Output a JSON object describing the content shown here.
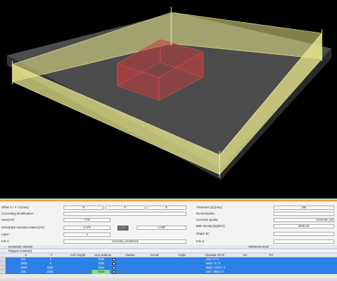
{
  "viewport": {
    "background": "#000000",
    "slab_color": "#4a4a4a",
    "wall_color": "#e8e88c",
    "opening_color": "#c44040"
  },
  "properties": {
    "accent_bar": "#e8a63a",
    "offset_label": "Offset X / Y / Z [mm]:",
    "offset_x": "0",
    "offset_y": "0",
    "offset_z": "0",
    "concreting_id_label": "Concreting identification:",
    "concreting_id_value": "",
    "area_label": "Area [m²]:",
    "area_value": "7.00",
    "scheduled_volume_label": "Scheduled concrete volume [m³]:",
    "scheduled_volume_value": "1.372",
    "volume_result": "1.400",
    "layer_label": "Layer:",
    "layer_value": "1",
    "info1_label": "Info 1:",
    "info1_value": "Concrete_Undefined",
    "thickness_label": "Thickness (Z) [mm]:",
    "thickness_value": "160",
    "denomination_label": "Denomination:",
    "denomination_value": "",
    "concrete_quality_label": "Concrete quality:",
    "concrete_quality_value": "Concrete_Un",
    "bulk_density_label": "Bulk density [Kg/dm³]:",
    "bulk_density_value": "4048.4m",
    "object_id_label": "Object ID:",
    "object_id_value": "",
    "info2_label": "Info 2:",
    "info2_value": ""
  },
  "grid": {
    "group_header": "Geometric element",
    "reference_header": "Reference level",
    "polygon_label": "Polygon (Contour)",
    "columns": [
      "X",
      "Y",
      "Arch height",
      "Line attribute",
      "Radius",
      "Center",
      "Angle",
      "Absolute X/Y/Z",
      "DX",
      "DY"
    ],
    "rows": [
      {
        "x": "100",
        "y": "0",
        "arch": "",
        "line": "3000",
        "abs": "100 / 0 / 0"
      },
      {
        "x": "3600",
        "y": "0",
        "arch": "",
        "line": "3000",
        "abs": "3600 / 0 / 0"
      },
      {
        "x": "3600",
        "y": "2800",
        "arch": "",
        "line": "3010",
        "abs": "3600 / 2800 / 0"
      },
      {
        "x": "100",
        "y": "2800",
        "arch": "",
        "line": "3040",
        "abs": "100 / 2800 / 0"
      }
    ]
  }
}
